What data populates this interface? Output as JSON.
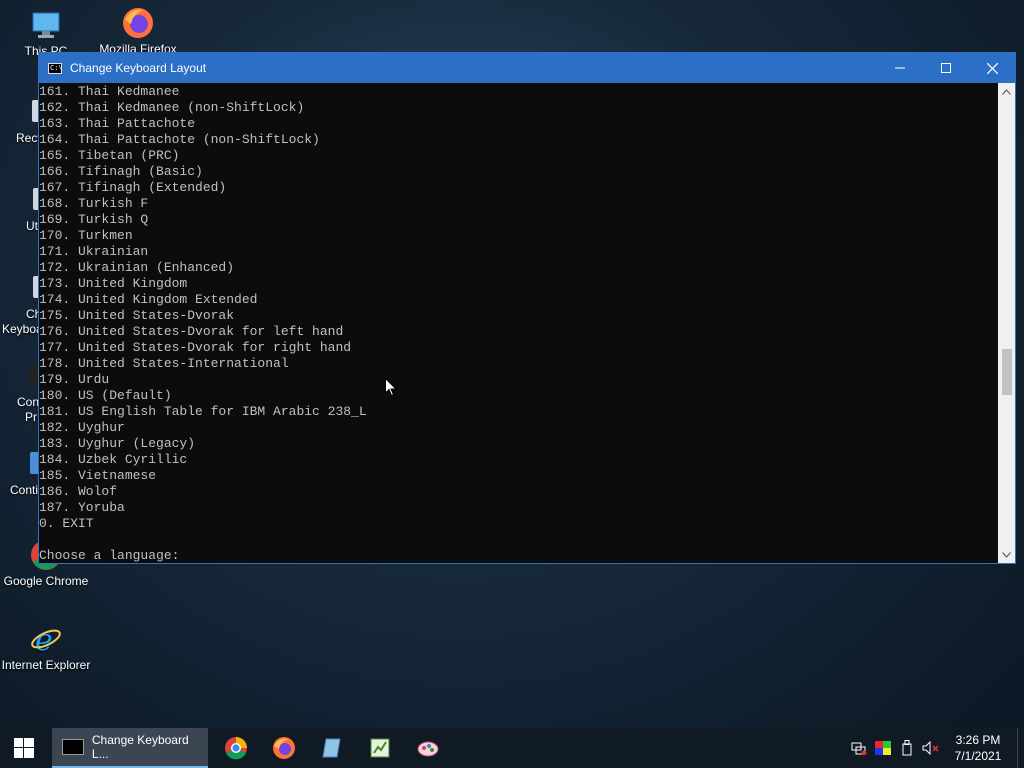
{
  "desktop": {
    "icons": [
      {
        "label": "This PC",
        "icon": "computer-icon"
      },
      {
        "label": "Mozilla Firefox",
        "icon": "firefox-icon"
      },
      {
        "label": "Google Chrome",
        "icon": "chrome-icon"
      },
      {
        "label": "Internet Explorer",
        "icon": "ie-icon"
      }
    ],
    "partial_labels": [
      "Recy",
      "Ut",
      "Ch",
      "Keyboa",
      "Con",
      "Pr",
      "Conti"
    ]
  },
  "window": {
    "title": "Change Keyboard Layout",
    "minimize_glyph": "—",
    "maximize_glyph": "☐",
    "close_glyph": "✕",
    "lines": [
      "161. Thai Kedmanee",
      "162. Thai Kedmanee (non-ShiftLock)",
      "163. Thai Pattachote",
      "164. Thai Pattachote (non-ShiftLock)",
      "165. Tibetan (PRC)",
      "166. Tifinagh (Basic)",
      "167. Tifinagh (Extended)",
      "168. Turkish F",
      "169. Turkish Q",
      "170. Turkmen",
      "171. Ukrainian",
      "172. Ukrainian (Enhanced)",
      "173. United Kingdom",
      "174. United Kingdom Extended",
      "175. United States-Dvorak",
      "176. United States-Dvorak for left hand",
      "177. United States-Dvorak for right hand",
      "178. United States-International",
      "179. Urdu",
      "180. US (Default)",
      "181. US English Table for IBM Arabic 238_L",
      "182. Uyghur",
      "183. Uyghur (Legacy)",
      "184. Uzbek Cyrillic",
      "185. Vietnamese",
      "186. Wolof",
      "187. Yoruba",
      "0. EXIT",
      "",
      "Choose a language:"
    ]
  },
  "taskbar": {
    "active_task_label": "Change Keyboard L...",
    "pinned": [
      "chrome-icon",
      "firefox-icon",
      "notepad-icon",
      "spreadsheet-icon",
      "paint-icon"
    ],
    "tray": [
      "network-icon",
      "color-icon",
      "usb-icon",
      "volume-muted-icon"
    ],
    "time": "3:26 PM",
    "date": "7/1/2021"
  },
  "colors": {
    "titlebar": "#2b6fc7",
    "console_bg": "#0c0c0c",
    "console_text": "#c0c0c0",
    "taskbar": "#101a24"
  }
}
